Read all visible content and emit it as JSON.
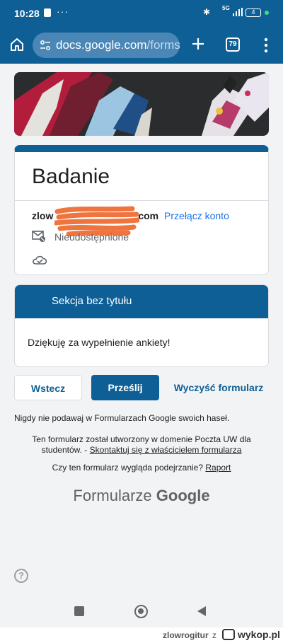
{
  "status_bar": {
    "time": "10:28",
    "network": "5G",
    "battery": "4"
  },
  "browser": {
    "url_host": "docs.google.com",
    "url_path": "/forms",
    "tabs_count": "79"
  },
  "form": {
    "title": "Badanie",
    "account_email": "zlow",
    "account_email_end": "com",
    "switch_account": "Przełącz konto",
    "not_shared": "Nieudostępnione"
  },
  "section": {
    "title": "Sekcja bez tytułu",
    "body": "Dziękuję za wypełnienie ankiety!"
  },
  "buttons": {
    "back": "Wstecz",
    "submit": "Prześlij",
    "clear": "Wyczyść formularz"
  },
  "notes": {
    "password_warning": "Nigdy nie podawaj w Formularzach Google swoich haseł.",
    "created_in": "Ten formularz został utworzony w domenie Poczta UW dla studentów. -",
    "contact_owner": "Skontaktuj się z właścicielem formularza",
    "suspicious": "Czy ten formularz wygląda podejrzanie?",
    "report": "Raport",
    "logo_prefix": "Formularze",
    "logo_brand": "Google"
  },
  "footer": {
    "user": "zlowrogitur",
    "z": "z",
    "brand": "wykop.pl"
  },
  "colors": {
    "theme": "#0d5f96",
    "background": "#f1f3f4",
    "link": "#1a73e8",
    "scribble": "#f0743e"
  }
}
